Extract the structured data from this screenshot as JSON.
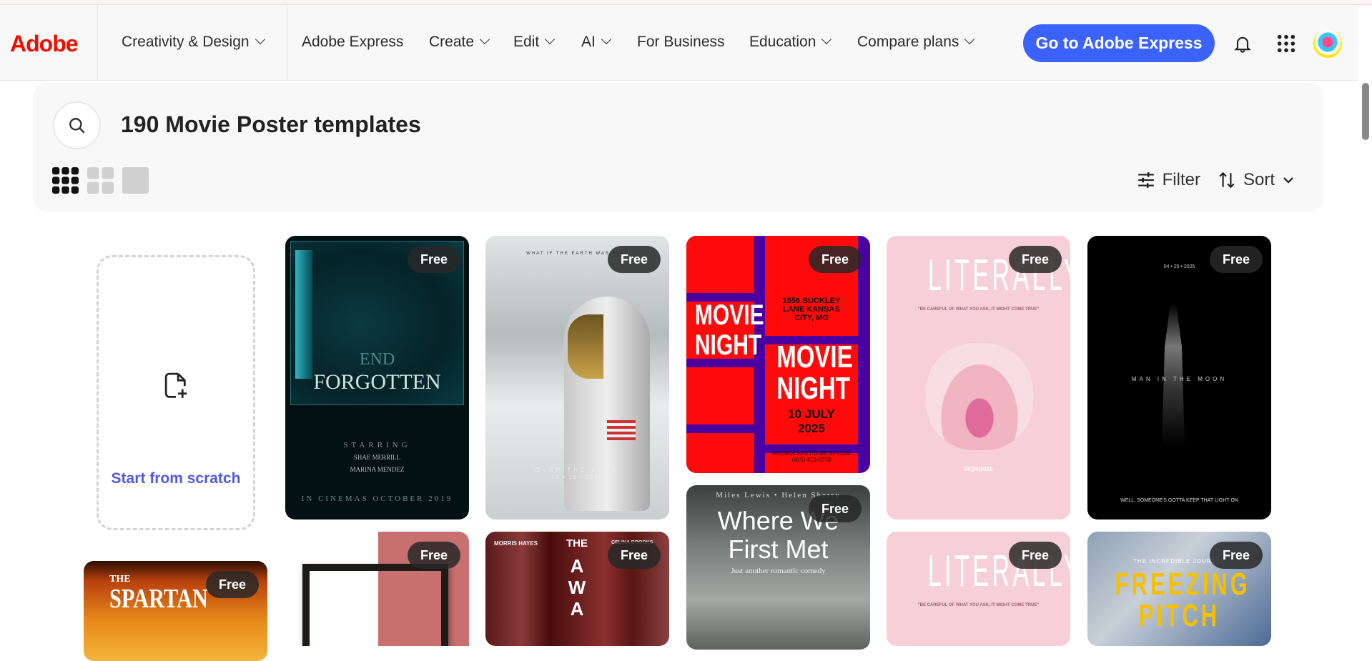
{
  "header": {
    "logo": "Adobe",
    "nav": [
      {
        "label": "Creativity & Design",
        "dropdown": true
      },
      {
        "label": "Adobe Express",
        "dropdown": false
      },
      {
        "label": "Create",
        "dropdown": true
      },
      {
        "label": "Edit",
        "dropdown": true
      },
      {
        "label": "AI",
        "dropdown": true
      },
      {
        "label": "For Business",
        "dropdown": false
      },
      {
        "label": "Education",
        "dropdown": true
      },
      {
        "label": "Compare plans",
        "dropdown": true
      }
    ],
    "cta": "Go to Adobe Express",
    "accent": "#3b63fb"
  },
  "search": {
    "title": "190 Movie Poster templates",
    "filter": "Filter",
    "sort": "Sort"
  },
  "scratch": {
    "label": "Start from scratch"
  },
  "badge": "Free",
  "posters": {
    "end_forgotten": {
      "t1": "END",
      "t2": "FORGOTTEN",
      "starring": "STARRING",
      "a1": "SHAE MERRILL",
      "a2": "MARINA MENDEZ",
      "date": "IN CINEMAS OCTOBER 2019"
    },
    "astronaut": {
      "tag": "WHAT IF THE EARTH WAS FLAT",
      "title": "OVER THE EDGE",
      "date": "10 • 18 • 2021"
    },
    "movie_night": {
      "w1": "MOVIE",
      "w2": "NIGHT",
      "addr": "1556 BUCKLEY LANE KANSAS CITY, MO",
      "date": "10 JULY 2025",
      "site": "REDROCKPETCLUB.SP.COM",
      "phone": "(415) 413-0703"
    },
    "literally": {
      "title": "LITERALLY",
      "quote": "\"BE CAREFUL OF WHAT YOU ASK, IT MIGHT COME TRUE\"",
      "date": "04|25|2025"
    },
    "moon": {
      "date": "04 • 25 • 2025",
      "title": "MAN IN THE MOON",
      "tagline": "WELL, SOMEONE'S GOTTA KEEP THAT LIGHT ON"
    },
    "where": {
      "names": "Miles Lewis • Helen Sherry",
      "title": "Where We First Met",
      "sub": "Just another romantic comedy"
    },
    "spartan": {
      "t1": "THE",
      "t2": "SPARTAN"
    },
    "awa": {
      "n1": "MORRIS HAYES",
      "t1": "THE",
      "t2": "AWA",
      "n2": "CELINA BROOKS"
    },
    "freezing": {
      "tag": "THE INCREDIBLE JOURNEY",
      "t1": "FREEZING",
      "t2": "PITCH"
    }
  }
}
